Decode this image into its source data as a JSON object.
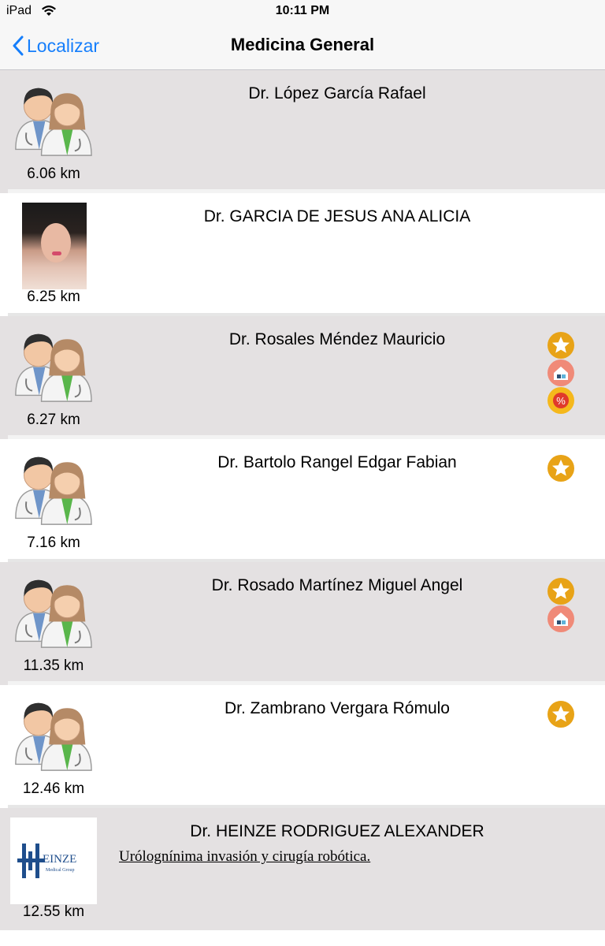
{
  "status_bar": {
    "device": "iPad",
    "time": "10:11 PM"
  },
  "nav": {
    "back_label": "Localizar",
    "title": "Medicina General"
  },
  "doctors": [
    {
      "name": "Dr. López García Rafael",
      "distance": "6.06 km",
      "badges": []
    },
    {
      "name": "Dr. GARCIA DE JESUS ANA ALICIA",
      "distance": "6.25 km",
      "badges": []
    },
    {
      "name": "Dr. Rosales Méndez Mauricio",
      "distance": "6.27 km",
      "badges": [
        "star-icon",
        "home-icon",
        "discount-icon"
      ]
    },
    {
      "name": "Dr. Bartolo Rangel Edgar Fabian",
      "distance": "7.16 km",
      "badges": [
        "star-icon"
      ]
    },
    {
      "name": "Dr. Rosado Martínez Miguel Angel",
      "distance": "11.35 km",
      "badges": [
        "star-icon",
        "home-icon"
      ]
    },
    {
      "name": "Dr. Zambrano Vergara Rómulo",
      "distance": "12.46 km",
      "badges": [
        "star-icon"
      ]
    },
    {
      "name": "Dr. HEINZE RODRIGUEZ ALEXANDER",
      "subtitle": "Urólognínima invasión y cirugía robótica.",
      "distance": "12.55 km",
      "badges": [],
      "logo_text": "EINZE",
      "logo_sub": "Medical Group"
    }
  ],
  "colors": {
    "accent": "#157efb",
    "row_gray": "#e4e1e2",
    "star": "#e8a317",
    "home": "#f08a78",
    "discount": "#f5b81c"
  }
}
